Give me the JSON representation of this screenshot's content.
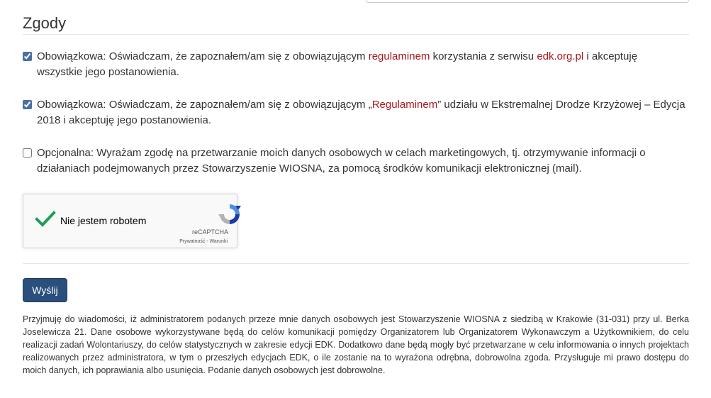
{
  "section": {
    "title": "Zgody"
  },
  "consents": [
    {
      "checked": true,
      "prefix": "Obowiązkowa: Oświadczam, że zapoznałem/am się z obowiązującym ",
      "link1": "regulaminem",
      "middle": " korzystania z serwisu ",
      "link2": "edk.org.pl",
      "suffix": " i akceptuję wszystkie jego postanowienia."
    },
    {
      "checked": true,
      "prefix": "Obowiązkowa: Oświadczam, że zapoznałem/am się z obowiązującym „",
      "link1": "Regulaminem",
      "suffix": "” udziału w Ekstremalnej Drodze Krzyżowej – Edycja 2018 i akceptuję jego postanowienia."
    },
    {
      "checked": false,
      "text": "Opcjonalna: Wyrażam zgodę na przetwarzanie moich danych osobowych w celach marketingowych, tj. otrzymywanie informacji o działaniach podejmowanych przez Stowarzyszenie WIOSNA, za pomocą środków komunikacji elektronicznej (mail)."
    }
  ],
  "recaptcha": {
    "label": "Nie jestem robotem",
    "brand": "reCAPTCHA",
    "terms": "Prywatność - Warunki",
    "verified": true,
    "check_color": "#1e9e54"
  },
  "submit": {
    "label": "Wyślij"
  },
  "notice": "Przyjmuję do wiadomości, iż administratorem podanych przeze mnie danych osobowych jest Stowarzyszenie WIOSNA z siedzibą w Krakowie (31-031) przy ul. Berka Joselewicza 21.  Dane osobowe wykorzystywane będą do celów komunikacji pomiędzy Organizatorem lub Organizatorem Wykonawczym a Użytkownikiem, do celu realizacji zadań Wolontariuszy, do celów statystycznych w zakresie edycji EDK. Dodatkowo dane będą mogły być przetwarzane w celu informowania o innych projektach realizowanych przez administratora, w tym o przeszłych edycjach EDK, o ile zostanie na to wyrażona odrębna, dobrowolna zgoda. Przysługuje mi prawo dostępu do moich danych, ich poprawiania albo usunięcia. Podanie danych osobowych jest dobrowolne.",
  "colors": {
    "link": "#a5171c",
    "button": "#2a4f7c"
  }
}
